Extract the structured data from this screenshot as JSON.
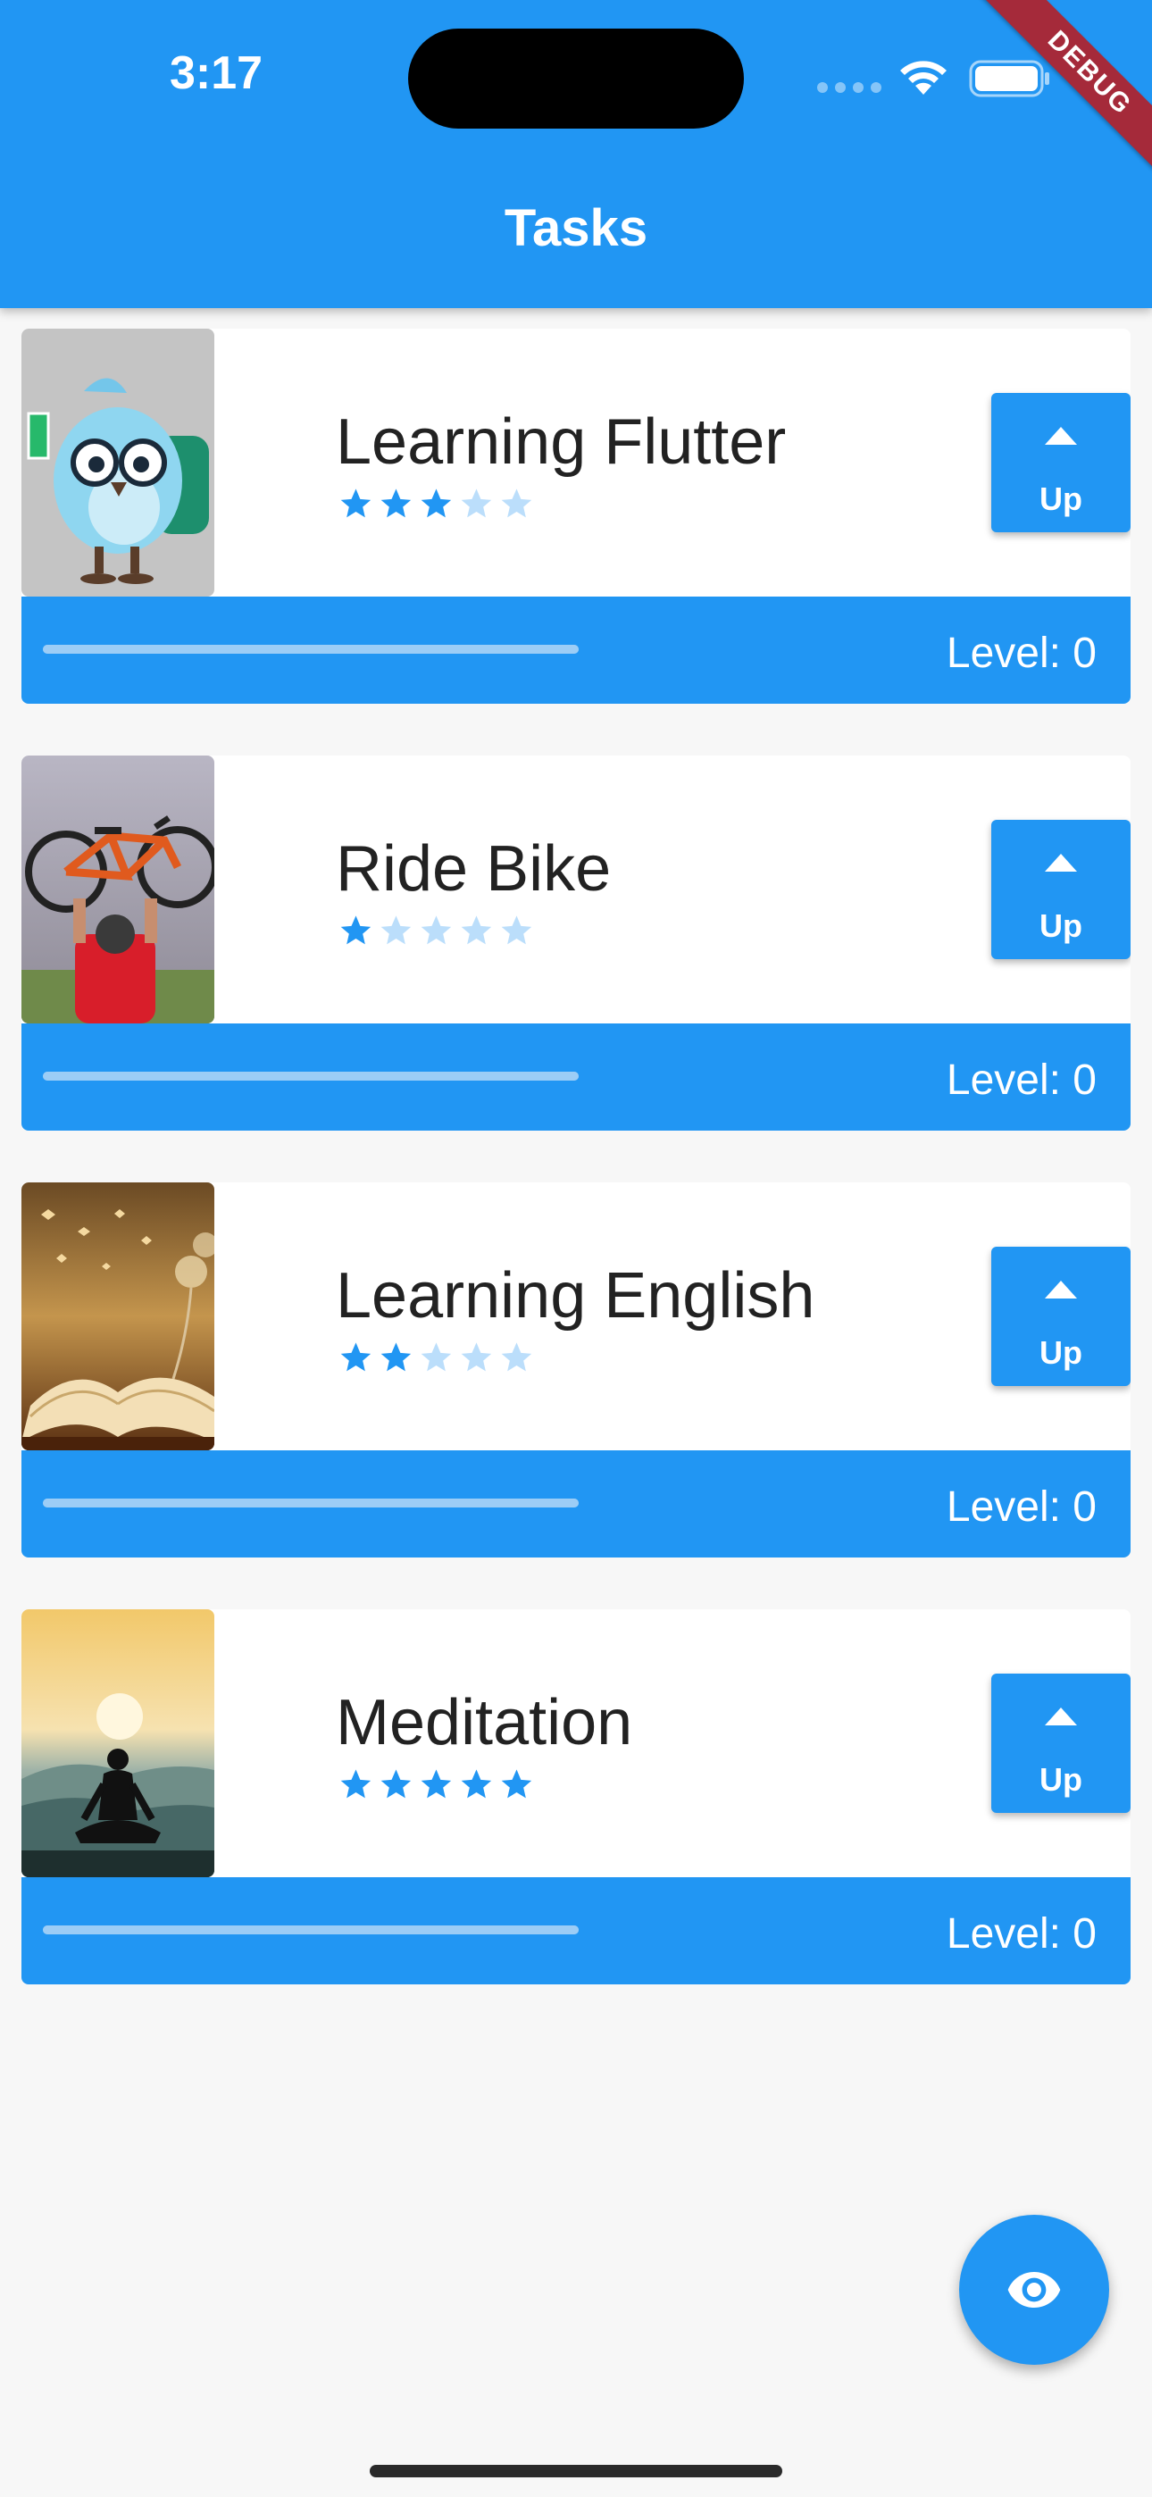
{
  "status_bar": {
    "time": "3:17"
  },
  "debug_banner": "DEBUG",
  "app_bar": {
    "title": "Tasks"
  },
  "colors": {
    "primary": "#2196f3",
    "star_filled": "#2196f3",
    "star_empty": "#bbdefb",
    "progress": "#9ccdf6"
  },
  "tasks": [
    {
      "name": "Learning Flutter",
      "difficulty": 3,
      "max_stars": 5,
      "up_label": "Up",
      "level_label": "Level: 0",
      "progress": 0,
      "image_icon": "flutter-mascot-image"
    },
    {
      "name": "Ride Bike",
      "difficulty": 1,
      "max_stars": 5,
      "up_label": "Up",
      "level_label": "Level: 0",
      "progress": 0,
      "image_icon": "bike-image"
    },
    {
      "name": "Learning English",
      "difficulty": 2,
      "max_stars": 5,
      "up_label": "Up",
      "level_label": "Level: 0",
      "progress": 0,
      "image_icon": "book-image"
    },
    {
      "name": "Meditation",
      "difficulty": 5,
      "max_stars": 5,
      "up_label": "Up",
      "level_label": "Level: 0",
      "progress": 0,
      "image_icon": "meditation-image"
    }
  ],
  "fab": {
    "icon": "eye-icon"
  }
}
